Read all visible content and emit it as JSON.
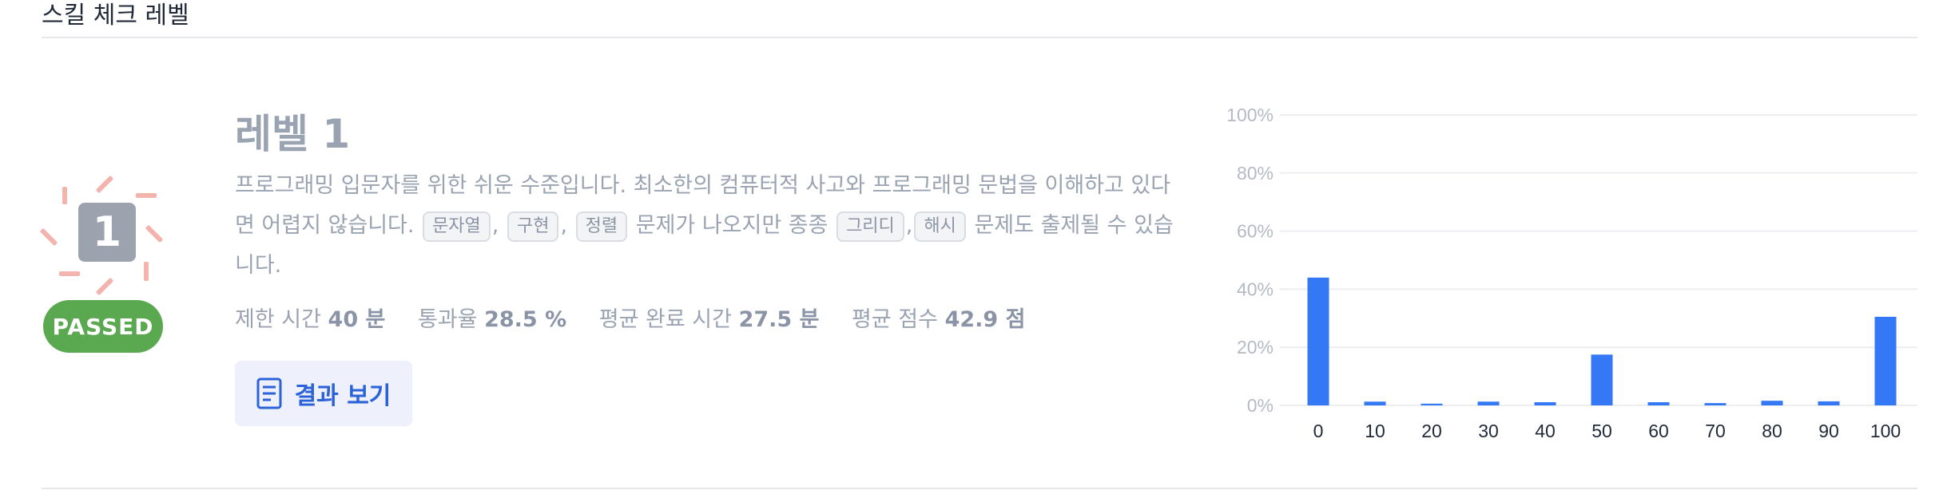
{
  "section": {
    "title": "스킬 체크 레벨"
  },
  "badge": {
    "number": "1",
    "status": "PASSED",
    "status_color": "#5aa84f"
  },
  "level": {
    "title": "레벨 1",
    "desc_1": "프로그래밍 입문자를 위한 쉬운 수준입니다. 최소한의 컴퓨터적 사고와 프로그래밍 문법을 이해하고 있다면 어렵지 않습니다.",
    "tag_1": "문자열",
    "tag_2": "구현",
    "tag_3": "정렬",
    "desc_2": "문제가 나오지만 종종",
    "tag_4": "그리디",
    "tag_5": "해시",
    "desc_3": "문제도 출제될 수 있습니다.",
    "comma": ","
  },
  "stats": {
    "time_label": "제한 시간",
    "time_value": "40 분",
    "pass_label": "통과율",
    "pass_value": "28.5 %",
    "avg_time_label": "평균 완료 시간",
    "avg_time_value": "27.5 분",
    "avg_score_label": "평균 점수",
    "avg_score_value": "42.9 점"
  },
  "result_button": {
    "label": "결과 보기",
    "icon": "document-icon"
  },
  "chart_data": {
    "type": "bar",
    "categories": [
      "0",
      "10",
      "20",
      "30",
      "40",
      "50",
      "60",
      "70",
      "80",
      "90",
      "100"
    ],
    "values": [
      44,
      1.3,
      0.6,
      1.3,
      1.1,
      17.5,
      1.1,
      0.8,
      1.6,
      1.4,
      30.5
    ],
    "yticks": [
      "0%",
      "20%",
      "40%",
      "60%",
      "80%",
      "100%"
    ],
    "ylim": [
      0,
      100
    ],
    "grid": true,
    "bar_color": "#3478f6"
  }
}
